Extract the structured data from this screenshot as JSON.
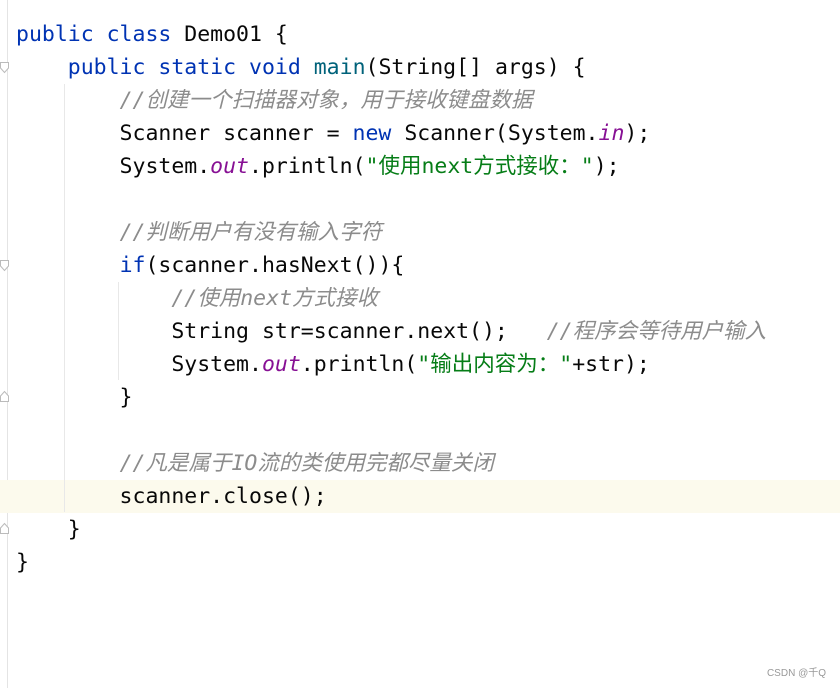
{
  "editor": {
    "current_line": 15,
    "colors": {
      "keyword": "#0033b3",
      "method": "#00627a",
      "static_field": "#871094",
      "string": "#067d17",
      "comment": "#8c8c8c",
      "current_line_bg": "#fcfaed"
    },
    "lines": [
      [
        [
          "kw",
          "public class "
        ],
        [
          "",
          "Demo01 {"
        ]
      ],
      [
        [
          "",
          "    "
        ],
        [
          "kw",
          "public static void "
        ],
        [
          "fn",
          "main"
        ],
        [
          "",
          "(String[] args) {"
        ]
      ],
      [
        [
          "",
          "        "
        ],
        [
          "cm",
          "//创建一个扫描器对象，用于接收键盘数据"
        ]
      ],
      [
        [
          "",
          "        Scanner scanner = "
        ],
        [
          "kw",
          "new "
        ],
        [
          "",
          "Scanner(System."
        ],
        [
          "st",
          "in"
        ],
        [
          "",
          ");"
        ]
      ],
      [
        [
          "",
          "        System."
        ],
        [
          "st",
          "out"
        ],
        [
          "",
          ".println("
        ],
        [
          "str",
          "\"使用next方式接收：\""
        ],
        [
          "",
          ");"
        ]
      ],
      [],
      [
        [
          "",
          "        "
        ],
        [
          "cm",
          "//判断用户有没有输入字符"
        ]
      ],
      [
        [
          "",
          "        "
        ],
        [
          "kw",
          "if"
        ],
        [
          "",
          "(scanner.hasNext()){"
        ]
      ],
      [
        [
          "",
          "            "
        ],
        [
          "cm",
          "//使用next方式接收"
        ]
      ],
      [
        [
          "",
          "            String str=scanner.next();   "
        ],
        [
          "cm",
          "//程序会等待用户输入"
        ]
      ],
      [
        [
          "",
          "            System."
        ],
        [
          "st",
          "out"
        ],
        [
          "",
          ".println("
        ],
        [
          "str",
          "\"输出内容为：\""
        ],
        [
          "",
          "+str);"
        ]
      ],
      [
        [
          "",
          "        }"
        ]
      ],
      [],
      [
        [
          "",
          "        "
        ],
        [
          "cm",
          "//凡是属于IO流的类使用完都尽量关闭"
        ]
      ],
      [
        [
          "",
          "        scanner.close();"
        ]
      ],
      [
        [
          "",
          "    }"
        ]
      ],
      [
        [
          "",
          "}"
        ]
      ]
    ]
  },
  "watermark": "CSDN @千Q"
}
